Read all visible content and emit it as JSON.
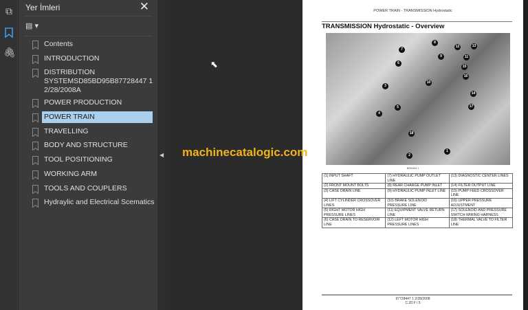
{
  "sidebar_rail": {
    "icons": [
      "pages-icon",
      "bookmark-icon",
      "attachment-icon"
    ],
    "active_color": "#3b9cf0"
  },
  "panel": {
    "title": "Yer İmleri",
    "close": "✕",
    "options_icon": "▤ ▾",
    "items": [
      {
        "label": "Contents"
      },
      {
        "label": "INTRODUCTION"
      },
      {
        "label": "DISTRIBUTION SYSTEMSD85BD95B87728447 1 2/28/2008A"
      },
      {
        "label": "POWER PRODUCTION"
      },
      {
        "label": "POWER TRAIN",
        "selected": true
      },
      {
        "label": "TRAVELLING"
      },
      {
        "label": "BODY AND STRUCTURE"
      },
      {
        "label": "TOOL POSITIONING"
      },
      {
        "label": "WORKING ARM"
      },
      {
        "label": "TOOLS AND COUPLERS"
      },
      {
        "label": "Hydraylic and Electrical Scematics"
      }
    ]
  },
  "watermark": "machinecatalogic.com",
  "document": {
    "header": "POWER TRAIN - TRANSMISSION Hydrostatic",
    "title": "TRANSMISSION Hydrostatic - Overview",
    "figure_caption": "BD00494   1",
    "callouts": [
      "1",
      "2",
      "3",
      "4",
      "5",
      "6",
      "7",
      "8",
      "9",
      "10",
      "11",
      "12",
      "13",
      "14",
      "15",
      "16",
      "17",
      "18"
    ],
    "legend": [
      [
        "(1) INPUT SHAFT",
        "(7) HYDRAULIC PUMP OUTLET LINE",
        "(13) DIAGNOSTIC CENTER LINES"
      ],
      [
        "(2) FRONT MOUNT BOLTS",
        "(8) REAR CHARGE PUMP INLET",
        "(14) FILTER OUTPUT LINE"
      ],
      [
        "(3) CASE DRAIN LINE",
        "(9) HYDRAULIC PUMP INLET LINE",
        "(15) PUMP FEED CROSSOVER LINE"
      ],
      [
        "(4) LIFT CYLINDER CROSSOVER LINES",
        "(10) BRAKE SOLENOID PRESSURE LINE",
        "(16) UPPER PRESSURE ADJUSTMENT"
      ],
      [
        "(5) RIGHT MOTOR HIGH PRESSURE LINES",
        "(11) EQUIPMENT VALVE RETURN LINE",
        "(17) SOLENOID AND PRESSURE SWITCH WIRING HARNESS"
      ],
      [
        "(6) CASE DRAIN TO RESERVOIR LINE",
        "(12) LEFT MOTOR HIGH PRESSURE LINES",
        "(18) THERMAL VALVE TO FILTER LINE"
      ]
    ],
    "footer_line1": "97728447 1 2/28/2008",
    "footer_line2": "C.20.F / 5"
  }
}
